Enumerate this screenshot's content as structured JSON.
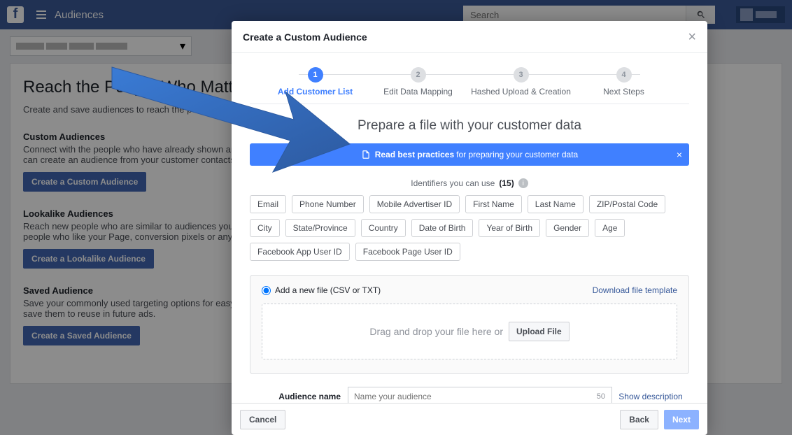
{
  "topbar": {
    "title": "Audiences",
    "search_placeholder": "Search"
  },
  "background": {
    "heading": "Reach the People Who Matter to You",
    "subtitle": "Create and save audiences to reach the people who matter to your business.",
    "sections": [
      {
        "title": "Custom Audiences",
        "desc": "Connect with the people who have already shown an interest in your business or product with Custom Audiences. You can create an audience from your customer contacts, website traffic or mobile app.",
        "button": "Create a Custom Audience"
      },
      {
        "title": "Lookalike Audiences",
        "desc": "Reach new people who are similar to audiences you already care about. You can create a lookalike audience based on people who like your Page, conversion pixels or any of your existing Custom Audiences.",
        "button": "Create a Lookalike Audience"
      },
      {
        "title": "Saved Audience",
        "desc": "Save your commonly used targeting options for easy reuse. Choose your demographics, interests, and behaviors, then save them to reuse in future ads.",
        "button": "Create a Saved Audience"
      }
    ]
  },
  "modal": {
    "title": "Create a Custom Audience",
    "steps": [
      {
        "num": "1",
        "label": "Add Customer List",
        "active": true
      },
      {
        "num": "2",
        "label": "Edit Data Mapping",
        "active": false
      },
      {
        "num": "3",
        "label": "Hashed Upload & Creation",
        "active": false
      },
      {
        "num": "4",
        "label": "Next Steps",
        "active": false
      }
    ],
    "section_title": "Prepare a file with your customer data",
    "banner": {
      "text_bold": "Read best practices",
      "text_rest": " for preparing your customer data"
    },
    "identifiers_label": "Identifiers you can use",
    "identifiers_count": "(15)",
    "identifiers": [
      "Email",
      "Phone Number",
      "Mobile Advertiser ID",
      "First Name",
      "Last Name",
      "ZIP/Postal Code",
      "City",
      "State/Province",
      "Country",
      "Date of Birth",
      "Year of Birth",
      "Gender",
      "Age",
      "Facebook App User ID",
      "Facebook Page User ID"
    ],
    "upload": {
      "radio_label": "Add a new file (CSV or TXT)",
      "download_link": "Download file template",
      "dropzone_text": "Drag and drop your file here or",
      "upload_btn": "Upload File"
    },
    "audience_name": {
      "label": "Audience name",
      "placeholder": "Name your audience",
      "counter": "50",
      "show_desc": "Show description"
    },
    "footer": {
      "cancel": "Cancel",
      "back": "Back",
      "next": "Next"
    }
  }
}
